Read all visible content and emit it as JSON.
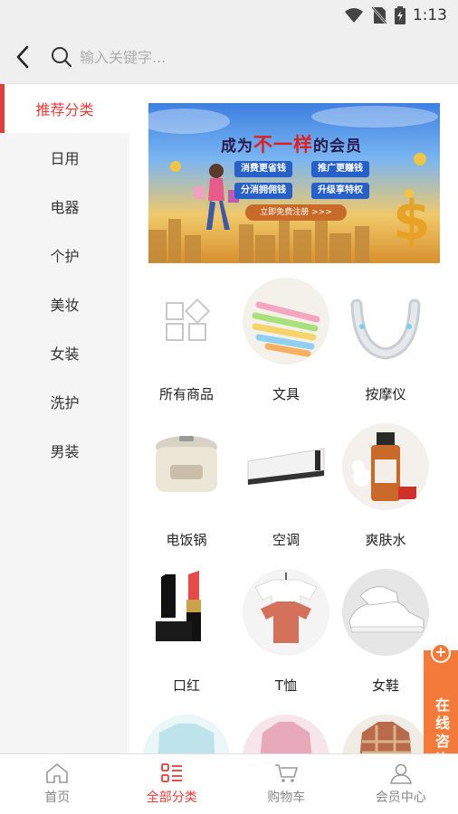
{
  "status": {
    "time": "1:13"
  },
  "search": {
    "placeholder": "输入关键字..."
  },
  "sidebar": {
    "items": [
      {
        "label": "推荐分类",
        "active": true
      },
      {
        "label": "日用"
      },
      {
        "label": "电器"
      },
      {
        "label": "个护"
      },
      {
        "label": "美妆"
      },
      {
        "label": "女装"
      },
      {
        "label": "洗护"
      },
      {
        "label": "男装"
      }
    ]
  },
  "banner": {
    "title_pre": "成为",
    "title_hl": "不一样",
    "title_post": "的会员",
    "tags": [
      "消费更省钱",
      "推广更赚钱",
      "分消拥佣钱",
      "升级享特权"
    ],
    "cta": "立即免费注册 >>>"
  },
  "categories": [
    {
      "label": "所有商品",
      "icon": "grid-icon"
    },
    {
      "label": "文具",
      "icon": "pencils-image"
    },
    {
      "label": "按摩仪",
      "icon": "neck-massager-image"
    },
    {
      "label": "电饭锅",
      "icon": "rice-cooker-image"
    },
    {
      "label": "空调",
      "icon": "air-conditioner-image"
    },
    {
      "label": "爽肤水",
      "icon": "toner-bottle-image"
    },
    {
      "label": "口红",
      "icon": "lipstick-image"
    },
    {
      "label": "T恤",
      "icon": "tshirt-image"
    },
    {
      "label": "女鞋",
      "icon": "sneakers-image"
    }
  ],
  "consult": {
    "label": "在线咨询"
  },
  "tabbar": {
    "tabs": [
      {
        "label": "首页",
        "icon": "home-icon"
      },
      {
        "label": "全部分类",
        "icon": "category-icon",
        "active": true
      },
      {
        "label": "购物车",
        "icon": "cart-icon"
      },
      {
        "label": "会员中心",
        "icon": "user-icon"
      }
    ]
  },
  "colors": {
    "accent": "#e63b39",
    "consult": "#f47a3a"
  }
}
